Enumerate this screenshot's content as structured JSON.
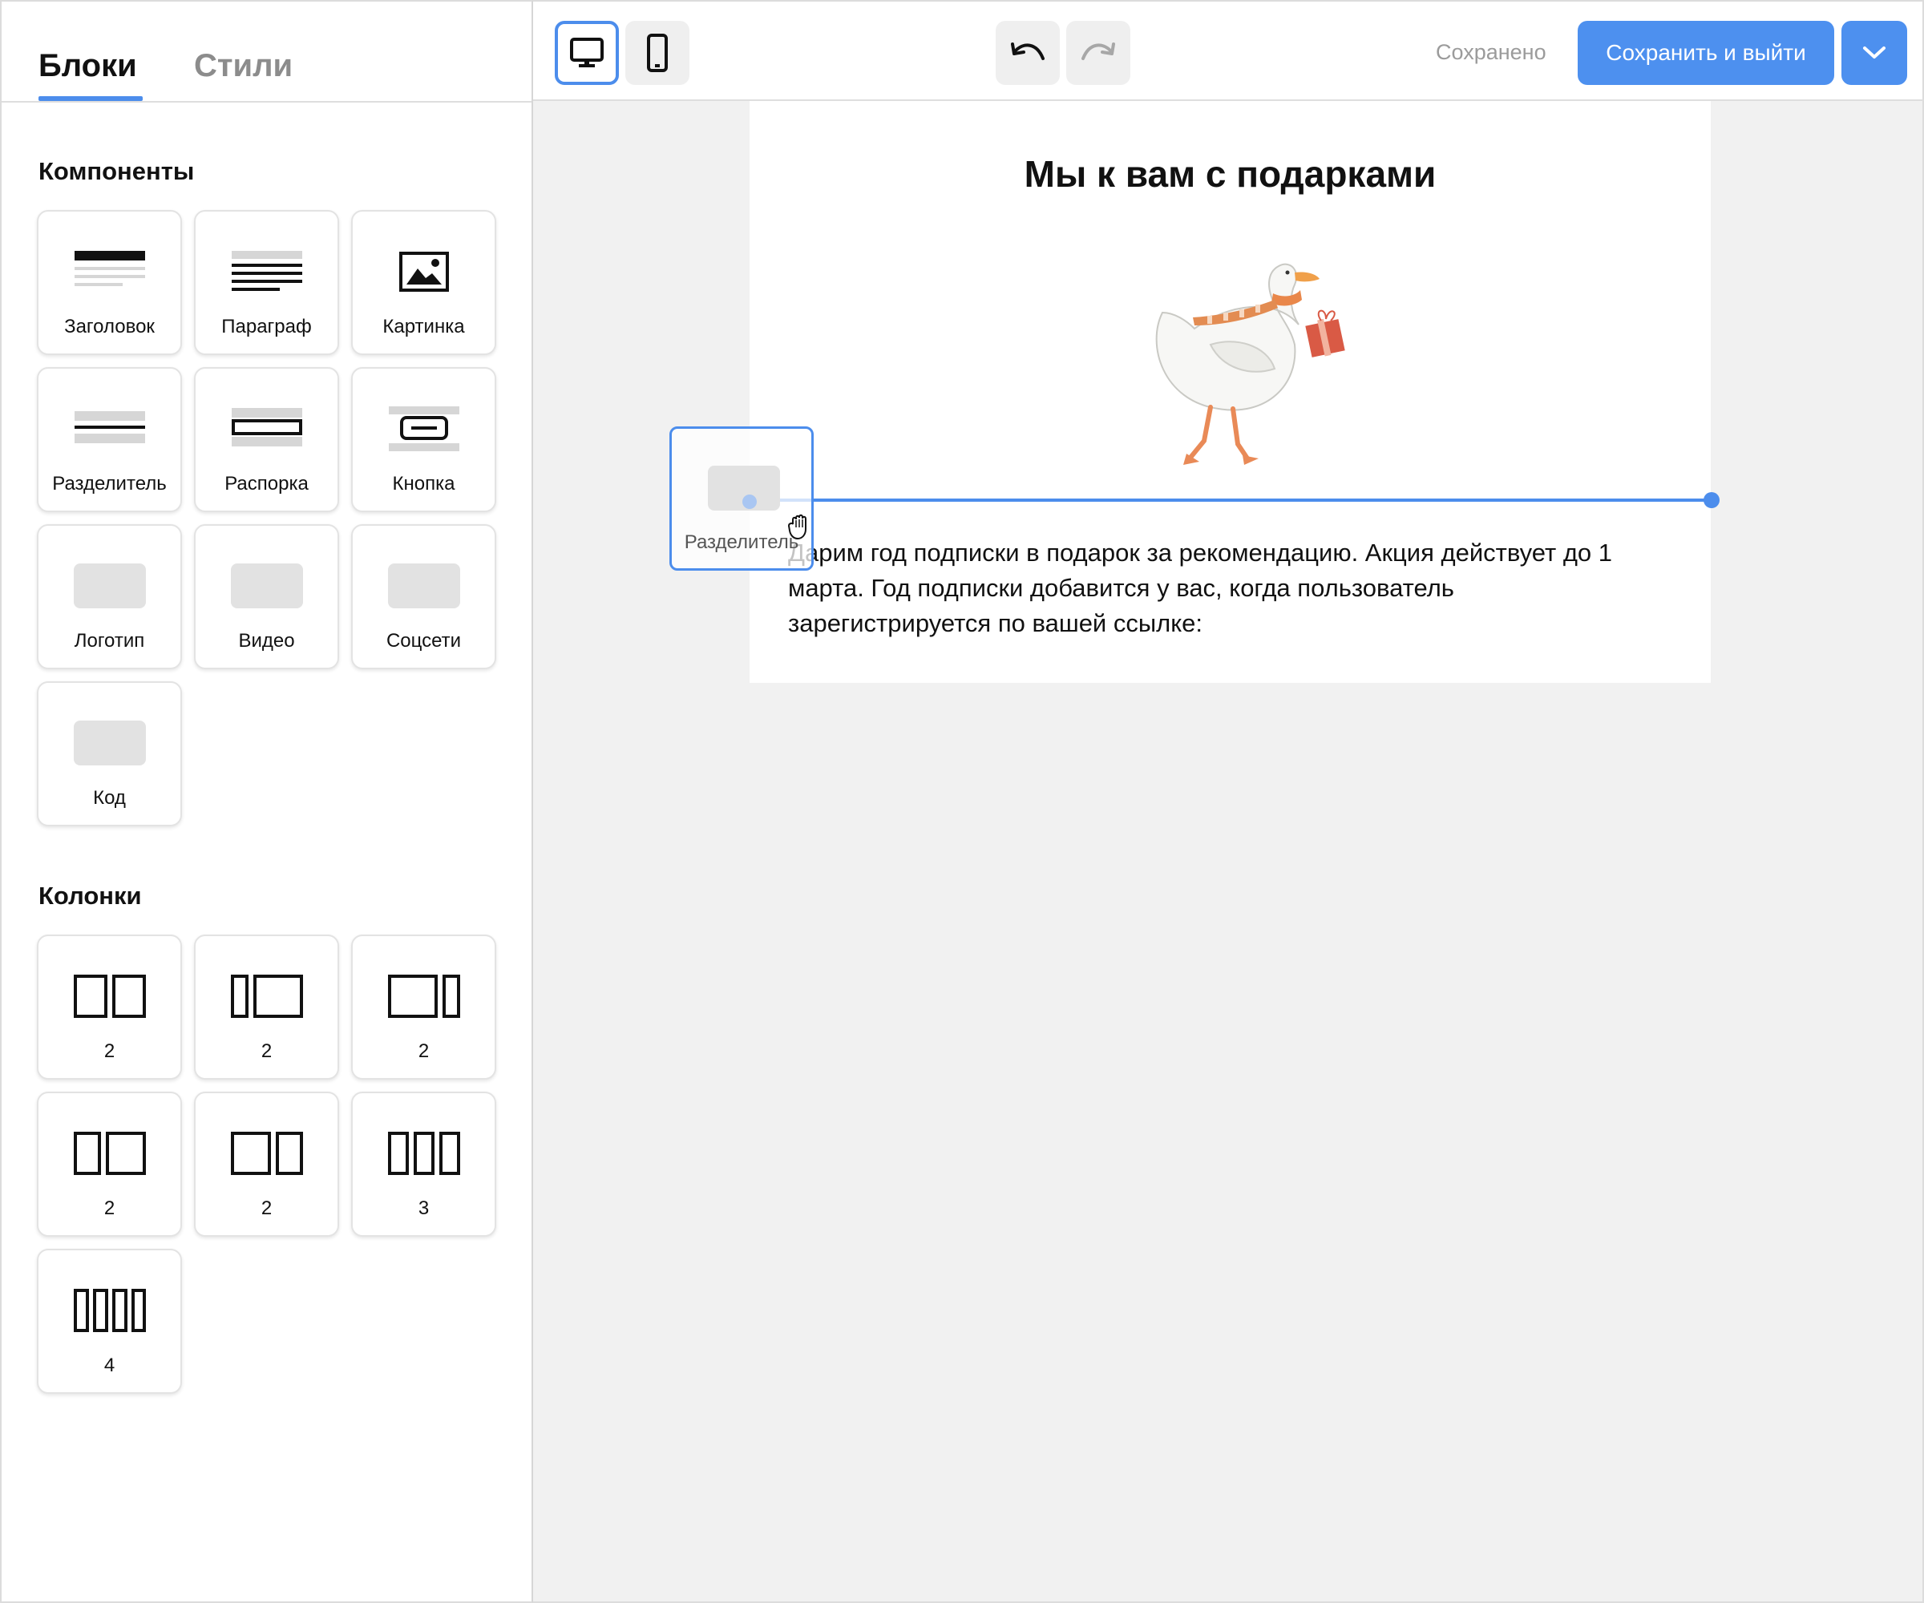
{
  "sidebar": {
    "tabs": [
      {
        "label": "Блоки",
        "active": true
      },
      {
        "label": "Стили",
        "active": false
      }
    ],
    "components_title": "Компоненты",
    "components": [
      {
        "label": "Заголовок",
        "icon": "heading-icon"
      },
      {
        "label": "Параграф",
        "icon": "paragraph-icon"
      },
      {
        "label": "Картинка",
        "icon": "image-icon"
      },
      {
        "label": "Разделитель",
        "icon": "divider-icon"
      },
      {
        "label": "Распорка",
        "icon": "spacer-icon"
      },
      {
        "label": "Кнопка",
        "icon": "button-icon"
      },
      {
        "label": "Логотип",
        "icon": "logo-placeholder-icon"
      },
      {
        "label": "Видео",
        "icon": "video-placeholder-icon"
      },
      {
        "label": "Соцсети",
        "icon": "social-placeholder-icon"
      },
      {
        "label": "Код",
        "icon": "code-placeholder-icon"
      }
    ],
    "columns_title": "Колонки",
    "columns": [
      {
        "label": "2",
        "icon": "columns-equal-icon"
      },
      {
        "label": "2",
        "icon": "columns-narrow-wide-icon"
      },
      {
        "label": "2",
        "icon": "columns-wide-narrow-icon"
      },
      {
        "label": "2",
        "icon": "columns-two-icon"
      },
      {
        "label": "2",
        "icon": "columns-wide-left-icon"
      },
      {
        "label": "3",
        "icon": "columns-three-icon"
      },
      {
        "label": "4",
        "icon": "columns-four-icon"
      }
    ]
  },
  "toolbar": {
    "desktop_icon": "desktop-icon",
    "mobile_icon": "mobile-icon",
    "undo_icon": "undo-icon",
    "redo_icon": "redo-icon",
    "status": "Сохранено",
    "save_exit_label": "Сохранить и выйти",
    "menu_icon": "chevron-down-icon",
    "accent": "#4d90ef"
  },
  "email": {
    "heading": "Мы к вам с подарками",
    "image_icon": "goose-with-gift-illustration",
    "text": "Дарим год подписки в подарок за рекомендацию. Акция действует до 1 марта. Год подписки добавится у вас, когда пользователь зарегистрируется по вашей ссылке:"
  },
  "drag": {
    "label": "Разделитель",
    "cursor_icon": "grab-hand-icon"
  }
}
